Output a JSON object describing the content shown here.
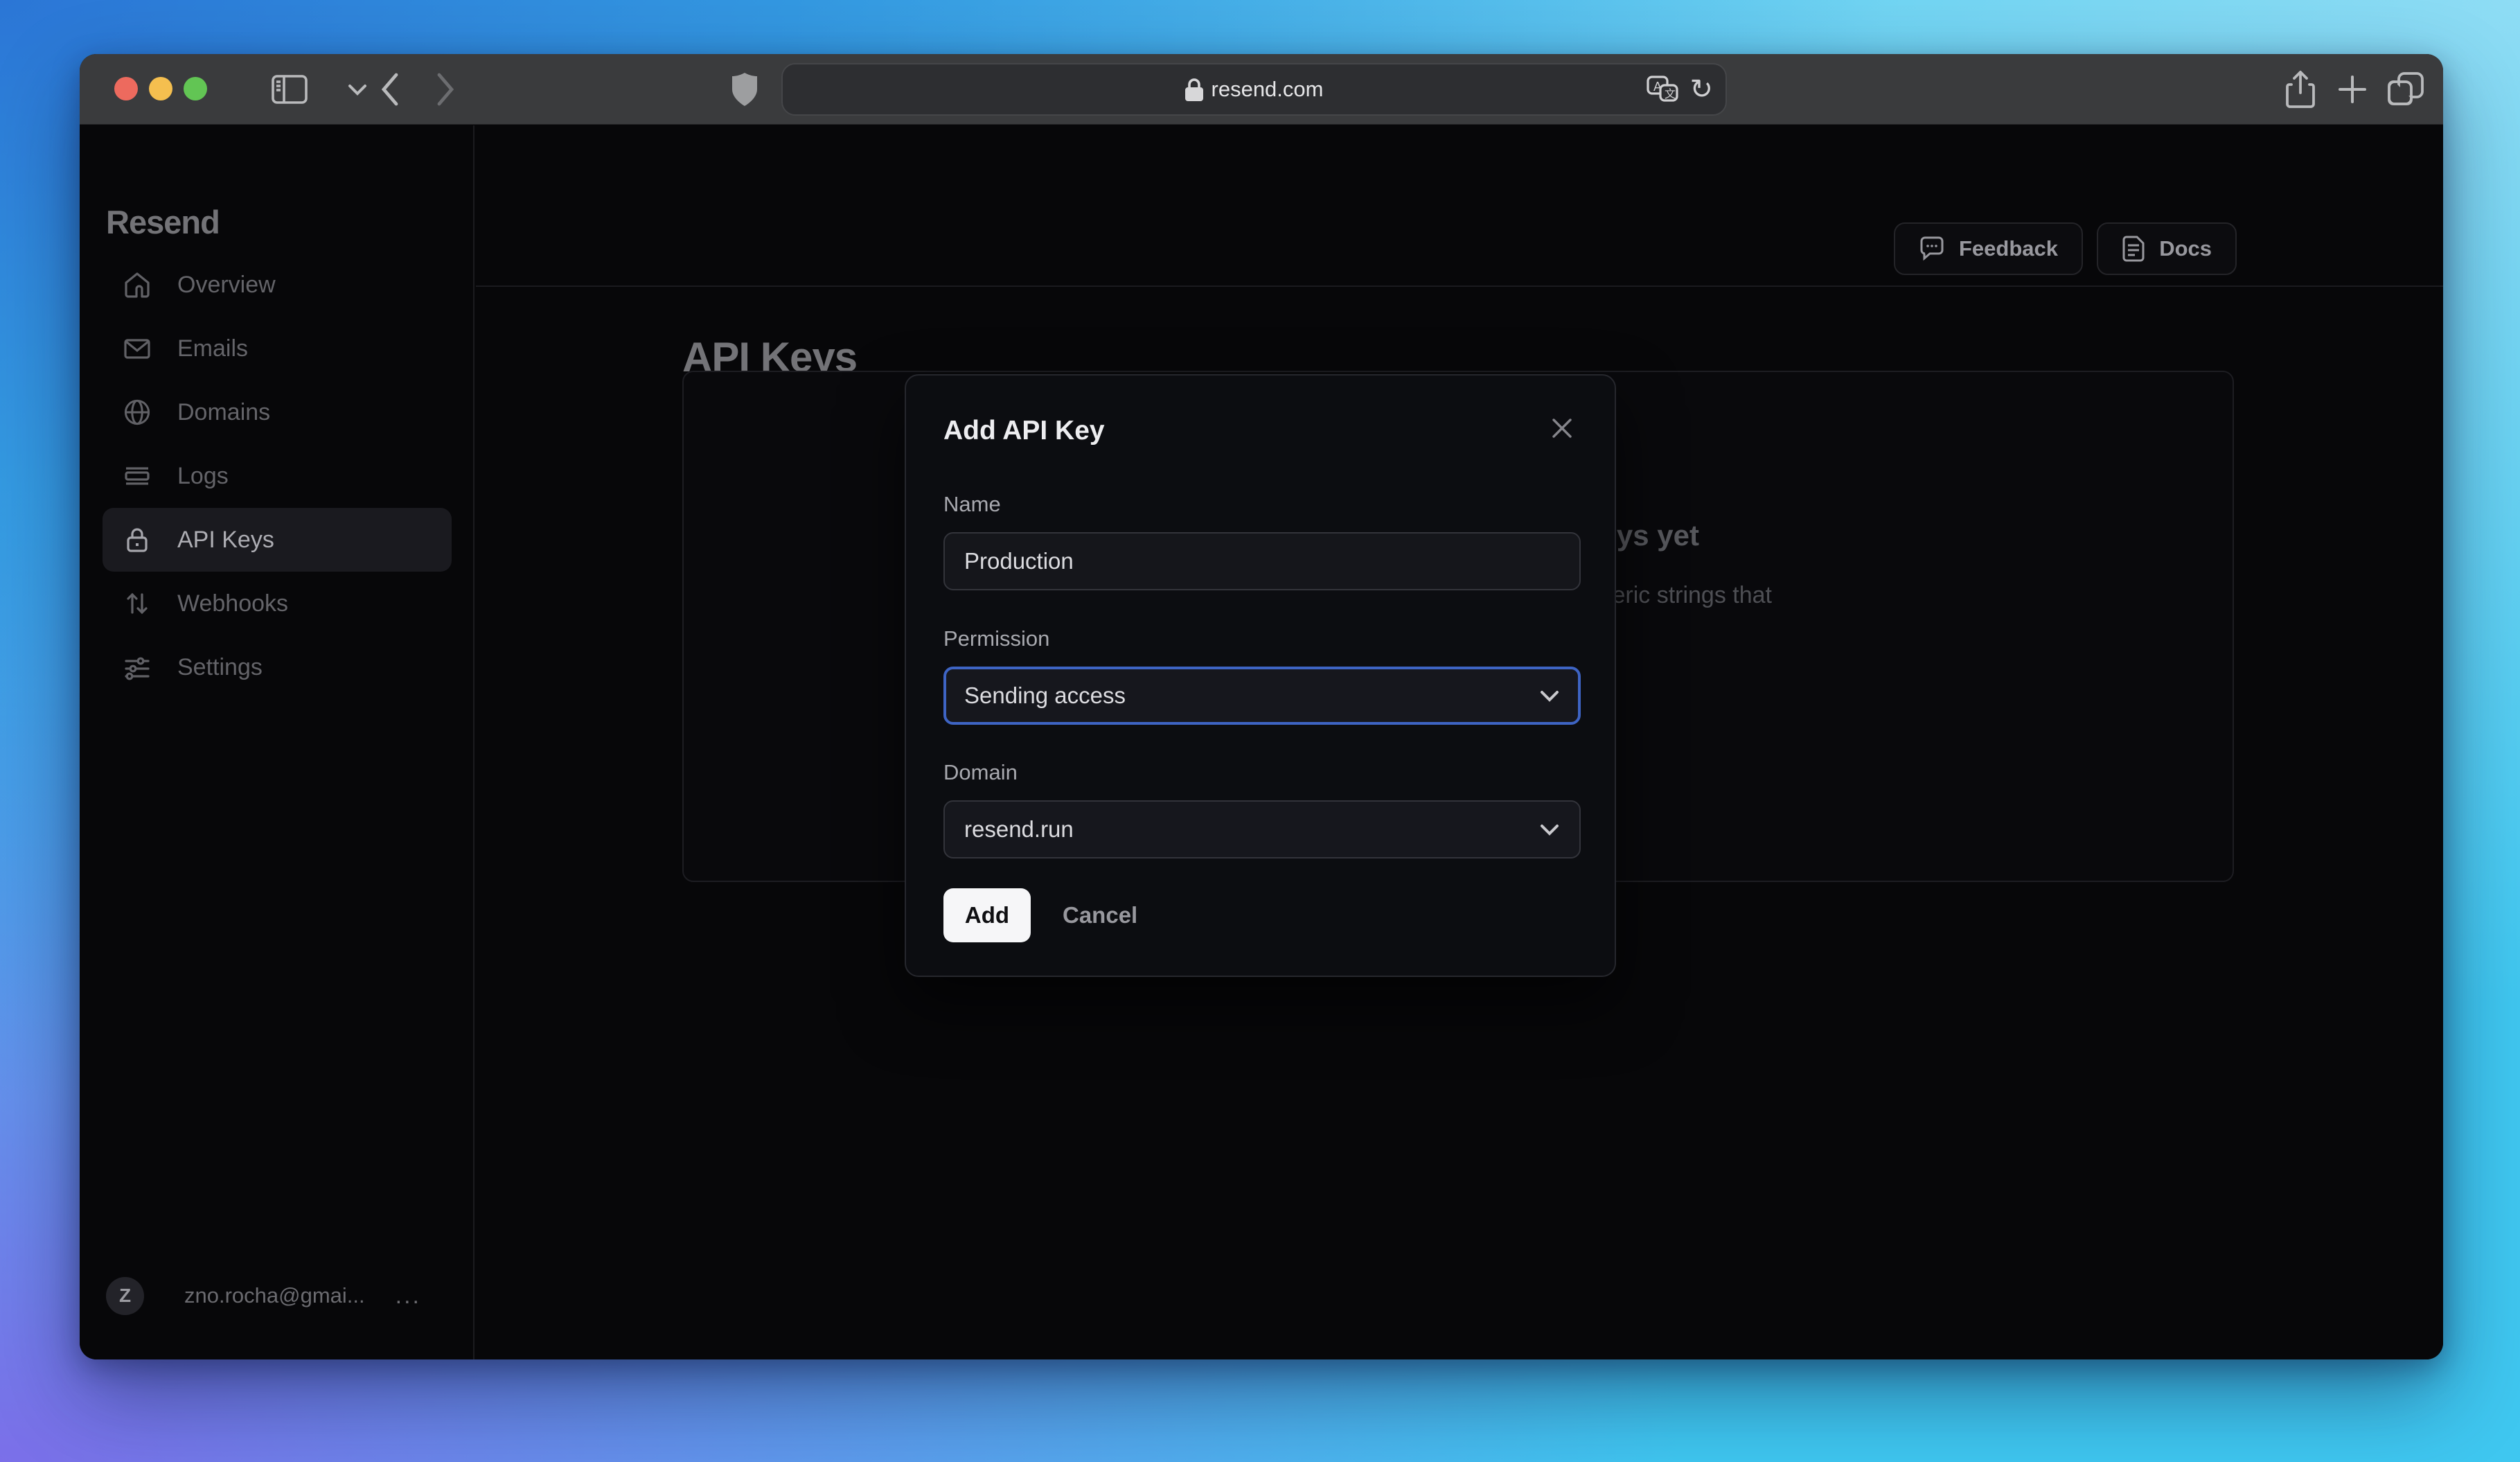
{
  "browser": {
    "url": "resend.com",
    "traffic_lights": {
      "close": "#ed6a5e",
      "minimize": "#f5bf4f",
      "zoom": "#62c554"
    }
  },
  "sidebar": {
    "logo": "Resend",
    "items": [
      {
        "label": "Overview",
        "icon": "home-icon",
        "active": false
      },
      {
        "label": "Emails",
        "icon": "envelope-icon",
        "active": false
      },
      {
        "label": "Domains",
        "icon": "globe-icon",
        "active": false
      },
      {
        "label": "Logs",
        "icon": "rows-icon",
        "active": false
      },
      {
        "label": "API Keys",
        "icon": "lock-icon",
        "active": true
      },
      {
        "label": "Webhooks",
        "icon": "arrows-up-down-icon",
        "active": false
      },
      {
        "label": "Settings",
        "icon": "sliders-icon",
        "active": false
      }
    ],
    "user": {
      "initial": "Z",
      "email": "zno.rocha@gmai...",
      "more": "..."
    }
  },
  "header": {
    "feedback_label": "Feedback",
    "docs_label": "Docs"
  },
  "main": {
    "page_title": "API Keys",
    "empty_state": {
      "heading": "You don't have any API Keys yet",
      "heading_visible_fragment": "ys yet",
      "description": "API keys are alphanumeric strings that",
      "description_visible_fragment": "eric strings that"
    }
  },
  "modal": {
    "title": "Add API Key",
    "name_field": {
      "label": "Name",
      "value": "Production"
    },
    "permission_field": {
      "label": "Permission",
      "value": "Sending access",
      "focused": true
    },
    "domain_field": {
      "label": "Domain",
      "value": "resend.run"
    },
    "add_label": "Add",
    "cancel_label": "Cancel"
  },
  "colors": {
    "focus_ring": "#3e64c4",
    "gradient_top_left": "#2b76d6",
    "gradient_top_right": "#8edcf4",
    "gradient_bottom_left": "#7b6fe9",
    "gradient_bottom_right": "#3fc7f0",
    "modal_background": "#0c0d11",
    "add_button_background": "#f6f6f8"
  }
}
